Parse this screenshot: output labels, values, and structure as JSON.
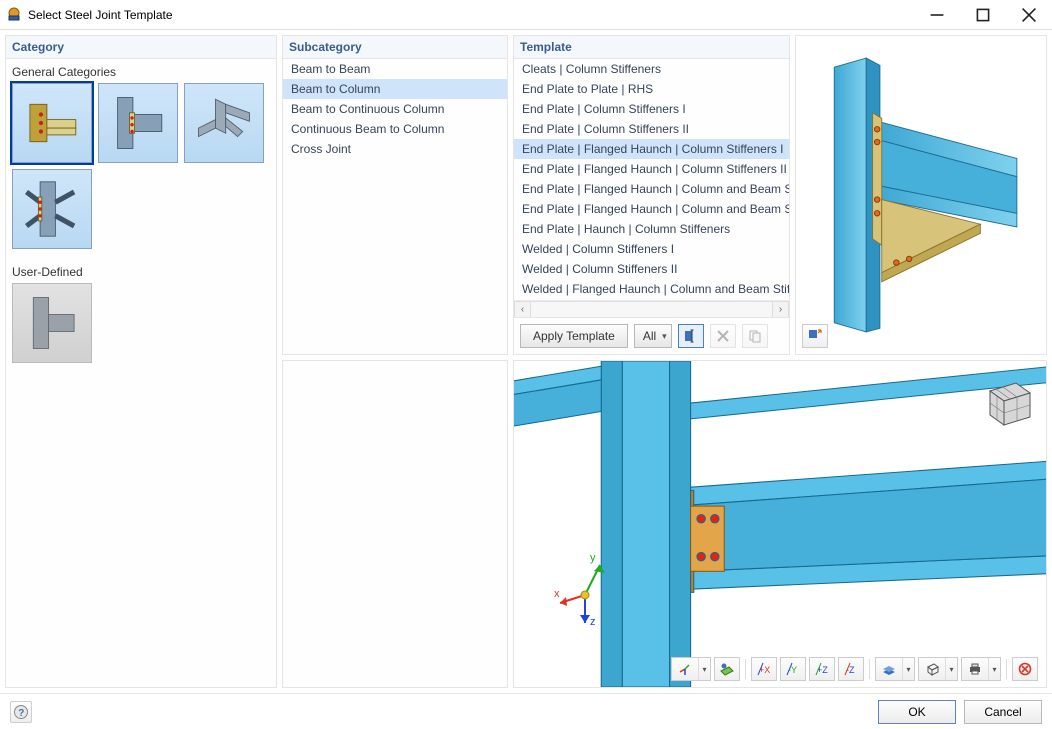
{
  "window": {
    "title": "Select Steel Joint Template"
  },
  "panels": {
    "category": "Category",
    "subcategory": "Subcategory",
    "template": "Template"
  },
  "category": {
    "section_general": "General Categories",
    "section_user": "User-Defined",
    "thumbs_general": [
      {
        "name": "cat-general-0"
      },
      {
        "name": "cat-general-1"
      },
      {
        "name": "cat-general-2"
      },
      {
        "name": "cat-general-3"
      }
    ],
    "thumbs_user": [
      {
        "name": "cat-user-0"
      }
    ]
  },
  "subcategory": {
    "items": [
      "Beam to Beam",
      "Beam to Column",
      "Beam to Continuous Column",
      "Continuous Beam to Column",
      "Cross Joint"
    ],
    "selected_index": 1
  },
  "template": {
    "items": [
      "Cleats | Column Stiffeners",
      "End Plate to Plate | RHS",
      "End Plate | Column Stiffeners I",
      "End Plate | Column Stiffeners II",
      "End Plate | Flanged Haunch | Column Stiffeners I",
      "End Plate | Flanged Haunch | Column Stiffeners II",
      "End Plate | Flanged Haunch | Column and Beam Stiffeners I",
      "End Plate | Flanged Haunch | Column and Beam Stiffeners II",
      "End Plate | Haunch | Column Stiffeners",
      "Welded | Column Stiffeners I",
      "Welded | Column Stiffeners II",
      "Welded | Flanged Haunch | Column and Beam Stiffeners"
    ],
    "selected_index": 4,
    "apply_label": "Apply Template",
    "filter_value": "All"
  },
  "viewport": {
    "axes": {
      "x": "x",
      "y": "y",
      "z": "z"
    }
  },
  "footer": {
    "ok": "OK",
    "cancel": "Cancel"
  },
  "colors": {
    "accent": "#3a5d8f",
    "sel_bg": "#cfe4fb",
    "steel": "#59c1e8",
    "plate": "#e2a54a"
  }
}
